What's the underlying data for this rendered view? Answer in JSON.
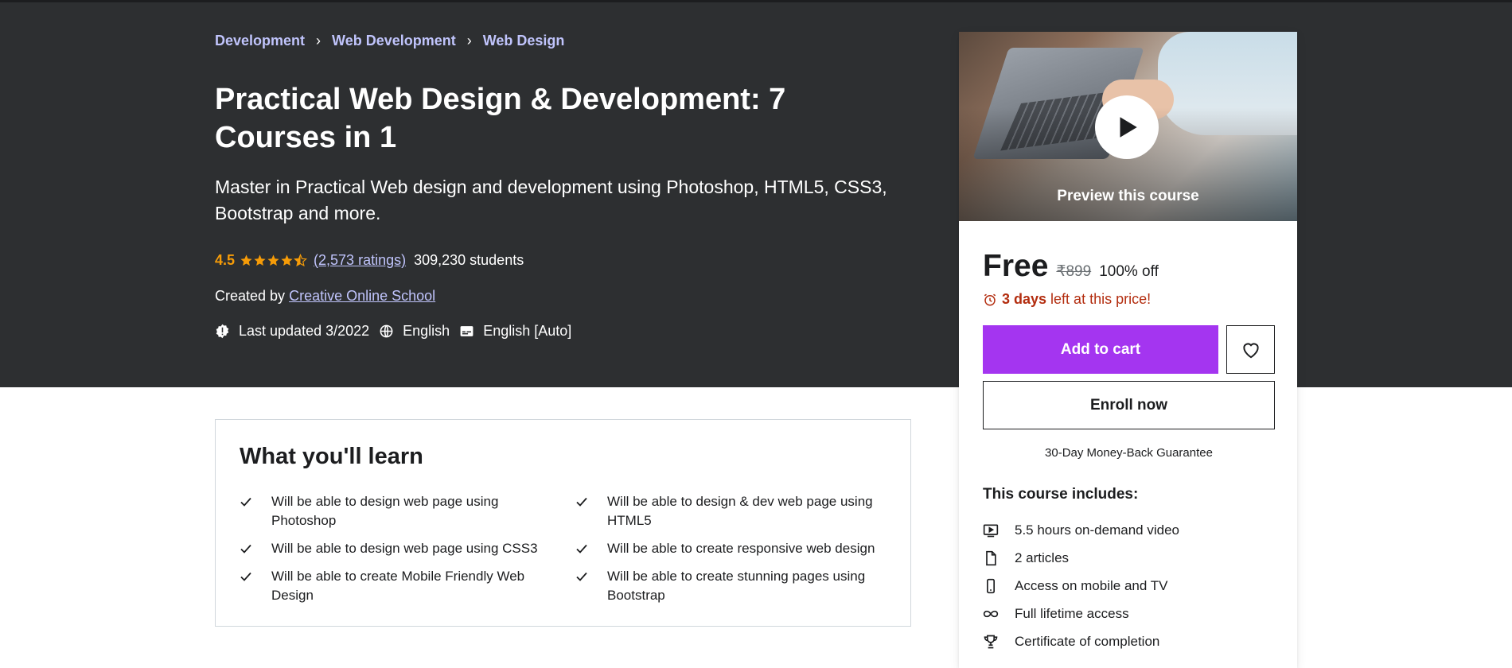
{
  "breadcrumb": [
    "Development",
    "Web Development",
    "Web Design"
  ],
  "course": {
    "title": "Practical Web Design & Development: 7 Courses in 1",
    "subtitle": "Master in Practical Web design and development using Photoshop, HTML5, CSS3, Bootstrap and more.",
    "rating": "4.5",
    "rating_value": 4.5,
    "ratings_count": "(2,573 ratings)",
    "students": "309,230 students",
    "created_by_label": "Created by",
    "instructor": "Creative Online School",
    "last_updated": "Last updated 3/2022",
    "language": "English",
    "captions": "English [Auto]"
  },
  "sidebar": {
    "preview_label": "Preview this course",
    "price": "Free",
    "original_price": "₹899",
    "discount": "100% off",
    "timer_bold": "3 days",
    "timer_rest": "left at this price!",
    "add_to_cart": "Add to cart",
    "enroll_now": "Enroll now",
    "guarantee": "30-Day Money-Back Guarantee",
    "includes_title": "This course includes:",
    "includes": [
      {
        "icon": "video-icon",
        "label": "5.5 hours on-demand video"
      },
      {
        "icon": "file-icon",
        "label": "2 articles"
      },
      {
        "icon": "mobile-icon",
        "label": "Access on mobile and TV"
      },
      {
        "icon": "infinity-icon",
        "label": "Full lifetime access"
      },
      {
        "icon": "trophy-icon",
        "label": "Certificate of completion"
      }
    ]
  },
  "learn": {
    "title": "What you'll learn",
    "items": [
      "Will be able to design web page using Photoshop",
      "Will be able to design & dev web page using HTML5",
      "Will be able to design web page using CSS3",
      "Will be able to create responsive web design",
      "Will be able to create Mobile Friendly Web Design",
      "Will be able to create stunning pages using Bootstrap"
    ]
  },
  "colors": {
    "hero_bg": "#2d2f31",
    "accent_purple": "#a435f0",
    "link_lavender": "#c0c4fc",
    "rating_orange": "#f69c08",
    "timer_red": "#b32d0f"
  }
}
